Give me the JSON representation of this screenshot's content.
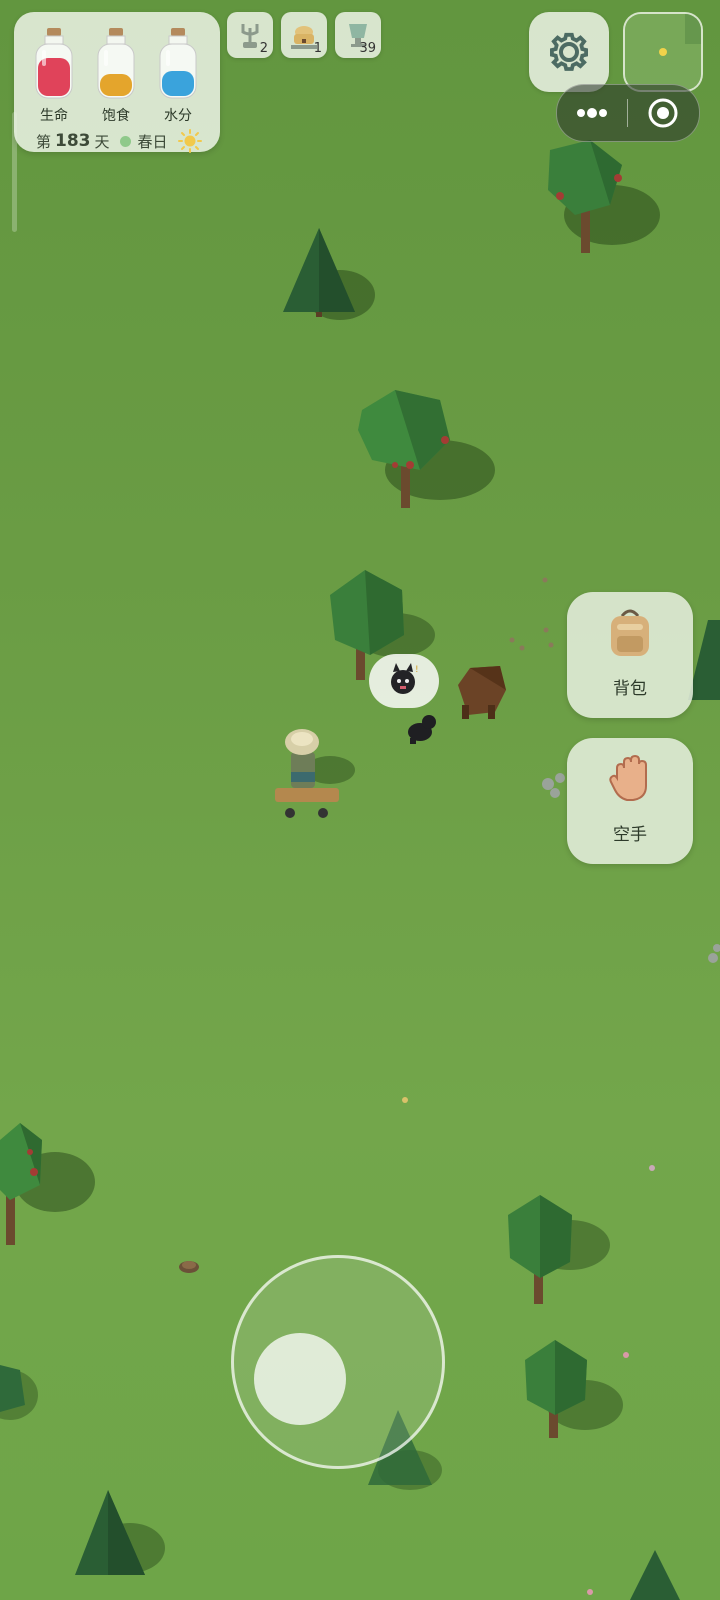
{
  "status": {
    "bars": [
      {
        "name": "health",
        "label": "生命",
        "color": "#e0435a",
        "level": 0.82
      },
      {
        "name": "satiety",
        "label": "饱食",
        "color": "#e4a52c",
        "level": 0.48
      },
      {
        "name": "hydration",
        "label": "水分",
        "color": "#3aa3dc",
        "level": 0.55
      }
    ],
    "day_prefix": "第",
    "day_number": "183",
    "day_suffix": "天",
    "season": "春日"
  },
  "resources": [
    {
      "icon": "trap-icon",
      "count": "2"
    },
    {
      "icon": "beehive-icon",
      "count": "1"
    },
    {
      "icon": "cup-icon",
      "count": "39"
    }
  ],
  "actions": {
    "backpack": "背包",
    "hand": "空手"
  },
  "colors": {
    "grass": "#6a9c44",
    "panel": "#e8f0e1",
    "tree_dark": "#2f6b3a",
    "tree_light": "#3f8a3e"
  }
}
